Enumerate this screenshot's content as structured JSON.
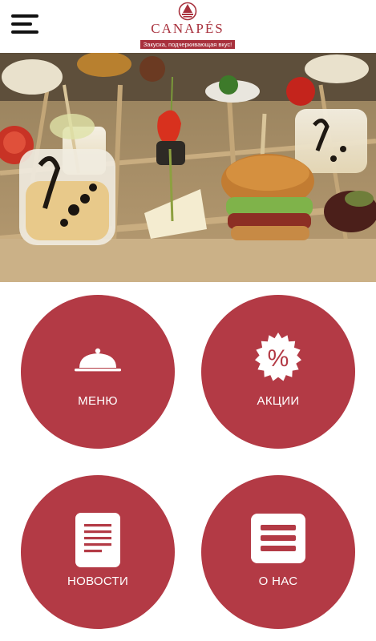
{
  "header": {
    "brand_name": "CANAPÉS",
    "tagline": "Закуска, подчеркивающая вкус!"
  },
  "colors": {
    "accent": "#b33a45",
    "brand": "#a8313d",
    "header_bg": "#ffffff"
  },
  "tiles": [
    {
      "label": "МЕНЮ",
      "icon": "cloche-icon"
    },
    {
      "label": "АКЦИИ",
      "icon": "percent-badge-icon"
    },
    {
      "label": "НОВОСТИ",
      "icon": "news-document-icon"
    },
    {
      "label": "О НАС",
      "icon": "about-list-icon"
    }
  ]
}
